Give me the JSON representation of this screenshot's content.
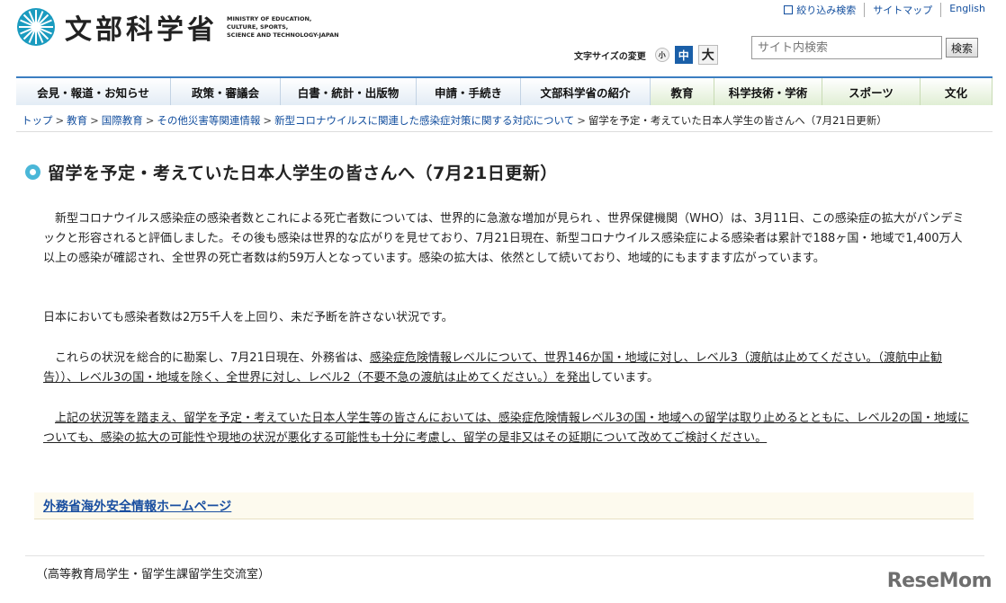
{
  "header": {
    "logo_text": "文部科学省",
    "logo_en": [
      "MINISTRY OF EDUCATION,",
      "CULTURE, SPORTS,",
      "SCIENCE AND TECHNOLOGY-JAPAN"
    ],
    "util_links": [
      "絞り込み検索",
      "サイトマップ",
      "English"
    ],
    "fontsize_label": "文字サイズの変更",
    "fontsize_small": "小",
    "fontsize_medium": "中",
    "fontsize_large": "大",
    "search_placeholder": "サイト内検索",
    "search_button": "検索"
  },
  "nav": {
    "items": [
      {
        "label": "会見・報道・お知らせ"
      },
      {
        "label": "政策・審議会"
      },
      {
        "label": "白書・統計・出版物"
      },
      {
        "label": "申請・手続き"
      },
      {
        "label": "文部科学省の紹介"
      },
      {
        "label": "教育"
      },
      {
        "label": "科学技術・学術"
      },
      {
        "label": "スポーツ"
      },
      {
        "label": "文化"
      }
    ]
  },
  "breadcrumb": {
    "items": [
      "トップ",
      "教育",
      "国際教育",
      "その他災害等関連情報",
      "新型コロナウイルスに関連した感染症対策に関する対応について"
    ],
    "current": "留学を予定・考えていた日本人学生の皆さんへ（7月21日更新）",
    "separator": ">"
  },
  "main": {
    "title": "留学を予定・考えていた日本人学生の皆さんへ（7月21日更新）",
    "p1": "新型コロナウイルス感染症の感染者数とこれによる死亡者数については、世界的に急激な増加が見られ 、世界保健機関（WHO）は、3月11日、この感染症の拡大がパンデミックと形容されると評価しました。その後も感染は世界的な広がりを見せており、7月21日現在、新型コロナウイルス感染症による感染者は累計で188ヶ国・地域で1,400万人以上の感染が確認され、全世界の死亡者数は約59万人となっています。感染の拡大は、依然として続いており、地域的にもますます広がっています。",
    "p2": "日本においても感染者数は2万5千人を上回り、未だ予断を許さない状況です。",
    "p3_a": "これらの状況を総合的に勘案し、7月21日現在、外務省は、",
    "p3_b": "感染症危険情報レベルについて、世界146か国・地域に対し、レベル3（渡航は止めてください。（渡航中止勧告））、レベル3の国・地域を除く、全世界に対し、レベル2（不要不急の渡航は止めてください。）を発出",
    "p3_c": "しています。",
    "p4": "上記の状況等を踏まえ、留学を予定・考えていた日本人学生等の皆さんにおいては、感染症危険情報レベル3の国・地域への留学は取り止めるとともに、レベル2の国・地域についても、感染の拡大の可能性や現地の状況が悪化する可能性も十分に考慮し、留学の是非又はその延期について改めてご検討ください。",
    "link": "外務省海外安全情報ホームページ",
    "footer_note": "（高等教育局学生・留学生課留学生交流室）"
  },
  "watermark": "ReseMom"
}
